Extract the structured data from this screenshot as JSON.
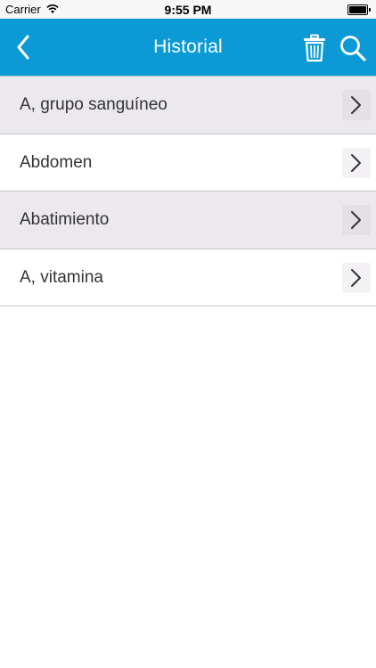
{
  "status_bar": {
    "carrier": "Carrier",
    "time": "9:55 PM",
    "wifi_icon": "wifi-icon",
    "battery_icon": "battery-icon",
    "battery_level": 1.0
  },
  "nav": {
    "title": "Historial",
    "back_icon": "chevron-left-icon",
    "trash_icon": "trash-icon",
    "search_icon": "search-icon",
    "bar_color": "#0b9ad6"
  },
  "history": {
    "items": [
      {
        "label": "A, grupo sanguíneo",
        "shaded": true
      },
      {
        "label": "Abdomen",
        "shaded": false
      },
      {
        "label": "Abatimiento",
        "shaded": true
      },
      {
        "label": "A, vitamina",
        "shaded": false
      }
    ],
    "item_icon": "chevron-right-icon"
  }
}
